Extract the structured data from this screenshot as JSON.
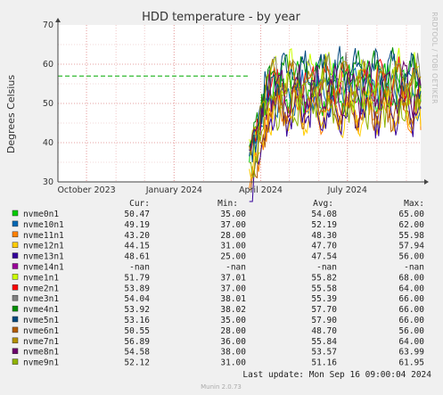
{
  "chart_data": {
    "type": "line",
    "title": "HDD temperature - by year",
    "ylabel": "Degrees Celsius",
    "ylim": [
      30,
      70
    ],
    "yticks": [
      30,
      40,
      50,
      60,
      70
    ],
    "xlim": [
      "2023-09-01",
      "2024-09-16"
    ],
    "xticks": [
      {
        "date": "2023-10-01",
        "label": "October 2023"
      },
      {
        "date": "2024-01-01",
        "label": "January 2024"
      },
      {
        "date": "2024-04-01",
        "label": "April 2024"
      },
      {
        "date": "2024-07-01",
        "label": "July 2024"
      }
    ],
    "grid": true,
    "warning_line": 57,
    "data_start": "2024-03-20",
    "side_label": "RRDTOOL / TOBI OETIKER",
    "footer": "Munin 2.0.73",
    "last_update": "Last update: Mon Sep 16 09:00:04 2024",
    "columns": [
      "Cur:",
      "Min:",
      "Avg:",
      "Max:"
    ],
    "series": [
      {
        "name": "nvme0n1",
        "color": "#00cc00",
        "cur": "50.47",
        "min": "35.00",
        "avg": "54.08",
        "max": "65.00"
      },
      {
        "name": "nvme10n1",
        "color": "#0066b3",
        "cur": "49.19",
        "min": "37.00",
        "avg": "52.19",
        "max": "62.00"
      },
      {
        "name": "nvme11n1",
        "color": "#ff8000",
        "cur": "43.20",
        "min": "28.00",
        "avg": "48.30",
        "max": "55.98"
      },
      {
        "name": "nvme12n1",
        "color": "#ffcc00",
        "cur": "44.15",
        "min": "31.00",
        "avg": "47.70",
        "max": "57.94"
      },
      {
        "name": "nvme13n1",
        "color": "#330099",
        "cur": "48.61",
        "min": "25.00",
        "avg": "47.54",
        "max": "56.00"
      },
      {
        "name": "nvme14n1",
        "color": "#990099",
        "cur": "-nan",
        "min": "-nan",
        "avg": "-nan",
        "max": "-nan"
      },
      {
        "name": "nvme1n1",
        "color": "#ccff00",
        "cur": "51.79",
        "min": "37.01",
        "avg": "55.82",
        "max": "68.00"
      },
      {
        "name": "nvme2n1",
        "color": "#ff0000",
        "cur": "53.89",
        "min": "37.00",
        "avg": "55.58",
        "max": "64.00"
      },
      {
        "name": "nvme3n1",
        "color": "#808080",
        "cur": "54.04",
        "min": "38.01",
        "avg": "55.39",
        "max": "66.00"
      },
      {
        "name": "nvme4n1",
        "color": "#008f00",
        "cur": "53.92",
        "min": "38.02",
        "avg": "57.70",
        "max": "66.00"
      },
      {
        "name": "nvme5n1",
        "color": "#00487d",
        "cur": "53.16",
        "min": "35.00",
        "avg": "57.90",
        "max": "66.00"
      },
      {
        "name": "nvme6n1",
        "color": "#b35a00",
        "cur": "50.55",
        "min": "28.00",
        "avg": "48.70",
        "max": "56.00"
      },
      {
        "name": "nvme7n1",
        "color": "#b38f00",
        "cur": "56.89",
        "min": "36.00",
        "avg": "55.84",
        "max": "64.00"
      },
      {
        "name": "nvme8n1",
        "color": "#6b006b",
        "cur": "54.58",
        "min": "38.00",
        "avg": "53.57",
        "max": "63.99"
      },
      {
        "name": "nvme9n1",
        "color": "#8fb300",
        "cur": "52.12",
        "min": "31.00",
        "avg": "51.16",
        "max": "61.95"
      }
    ]
  }
}
